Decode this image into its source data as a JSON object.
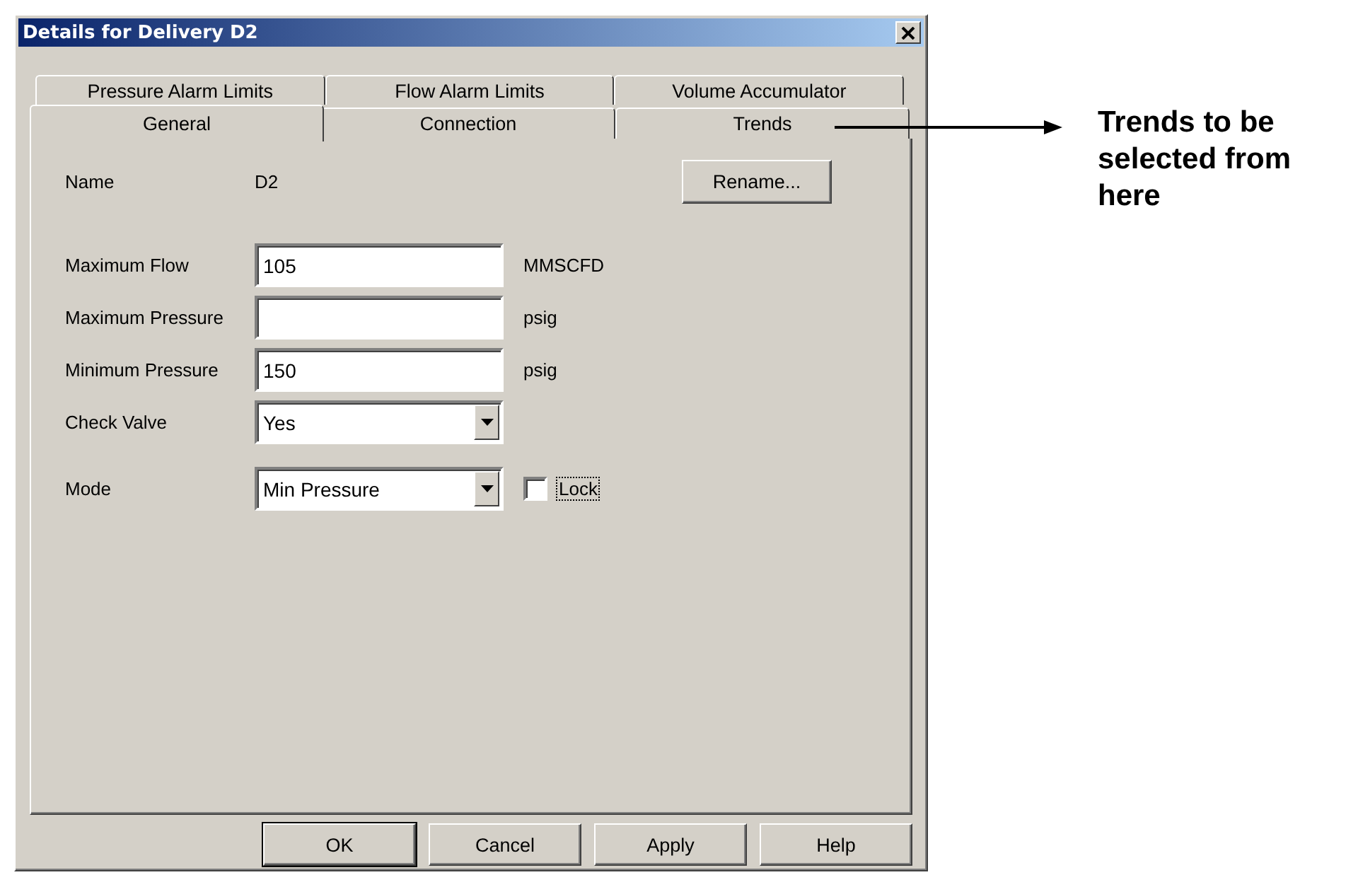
{
  "window": {
    "title": "Details for Delivery D2"
  },
  "tab_rows": [
    {
      "tabs": [
        {
          "label": "Pressure Alarm Limits",
          "selected": false
        },
        {
          "label": "Flow Alarm Limits",
          "selected": false
        },
        {
          "label": "Volume Accumulator",
          "selected": false
        }
      ]
    },
    {
      "tabs": [
        {
          "label": "General",
          "selected": true
        },
        {
          "label": "Connection",
          "selected": false
        },
        {
          "label": "Trends",
          "selected": false
        }
      ]
    }
  ],
  "name_row": {
    "label": "Name",
    "value": "D2",
    "button": "Rename..."
  },
  "fields": [
    {
      "kind": "text",
      "label": "Maximum Flow",
      "value": "105",
      "unit": "MMSCFD"
    },
    {
      "kind": "text",
      "label": "Maximum Pressure",
      "unit": "psig"
    },
    {
      "kind": "text",
      "label": "Minimum Pressure",
      "value": "150",
      "unit": "psig"
    },
    {
      "kind": "dropdown",
      "label": "Check Valve",
      "value": "Yes"
    },
    {
      "kind": "dropdown",
      "label": "Mode",
      "value": "Min Pressure",
      "checkbox": {
        "label": "Lock",
        "checked": false,
        "focused": true
      }
    }
  ],
  "buttons": [
    {
      "label": "OK",
      "default": true
    },
    {
      "label": "Cancel",
      "default": false
    },
    {
      "label": "Apply",
      "default": false
    },
    {
      "label": "Help",
      "default": false
    }
  ],
  "annotation": {
    "text": "Trends to be selected from here"
  }
}
